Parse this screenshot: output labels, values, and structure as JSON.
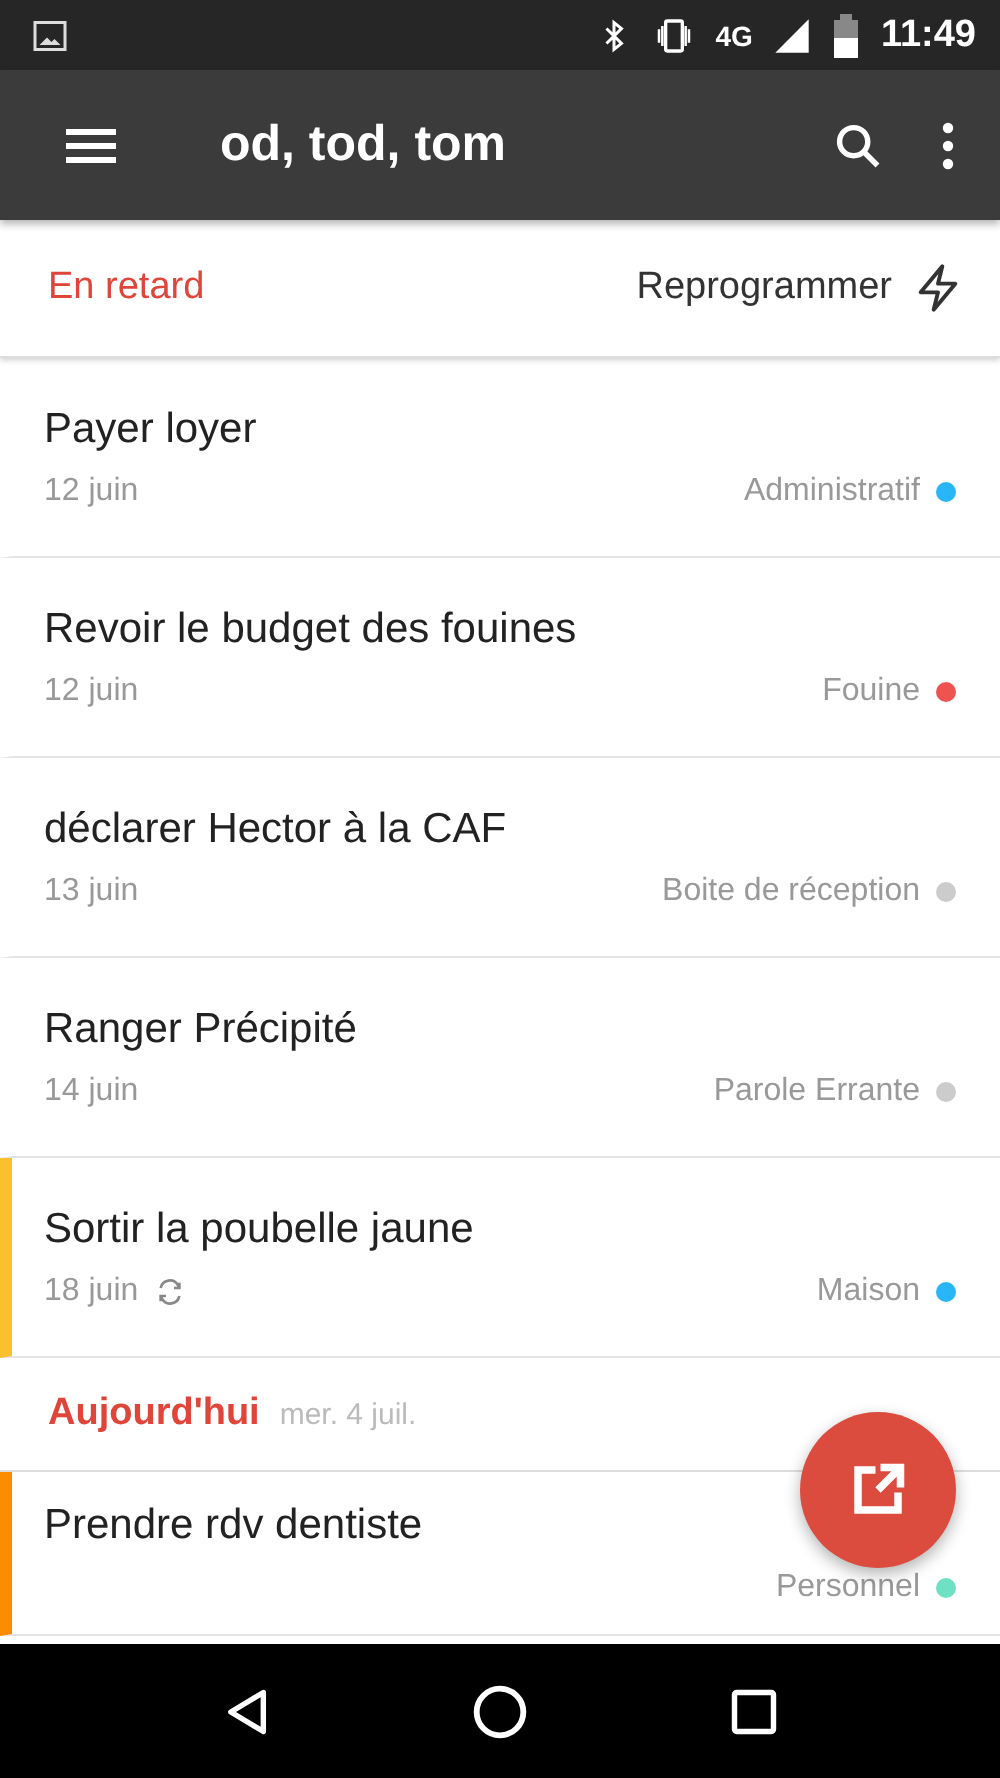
{
  "status_bar": {
    "network": "4G",
    "time": "11:49"
  },
  "toolbar": {
    "title": "od, tod, tom"
  },
  "overdue": {
    "title": "En retard",
    "action": "Reprogrammer"
  },
  "overdue_tasks": [
    {
      "title": "Payer loyer",
      "date": "12 juin",
      "project": "Administratif",
      "color": "#29b6f6"
    },
    {
      "title": "Revoir le budget des fouines",
      "date": "12 juin",
      "project": "Fouine",
      "color": "#ef5350"
    },
    {
      "title": "déclarer Hector à la CAF",
      "date": "13 juin",
      "project": "Boite de réception",
      "color": "#cccccc"
    },
    {
      "title": "Ranger Précipité",
      "date": "14 juin",
      "project": "Parole Errante",
      "color": "#cccccc"
    },
    {
      "title": "Sortir la poubelle jaune",
      "date": "18 juin",
      "project": "Maison",
      "color": "#29b6f6",
      "priority": {
        "color": "#fbc02d"
      },
      "recurring": true
    }
  ],
  "today": {
    "title": "Aujourd'hui",
    "date": "mer. 4 juil."
  },
  "today_tasks": [
    {
      "title": "Prendre rdv dentiste",
      "project": "Personnel",
      "color": "#6ee0c4",
      "priority": {
        "color": "#fb8c00"
      }
    }
  ]
}
